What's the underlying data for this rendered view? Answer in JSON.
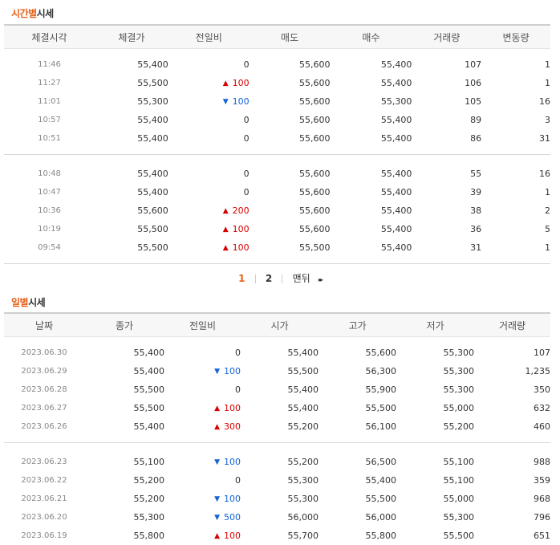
{
  "time_section": {
    "title_hl": "시간별",
    "title_rest": "시세",
    "headers": [
      "체결시각",
      "체결가",
      "전일비",
      "매도",
      "매수",
      "거래량",
      "변동량"
    ],
    "rows": [
      {
        "time": "11:46",
        "price": "55,400",
        "dir": "",
        "diff": "0",
        "ask": "55,600",
        "bid": "55,400",
        "volume": "107",
        "change": "1"
      },
      {
        "time": "11:27",
        "price": "55,500",
        "dir": "up",
        "diff": "100",
        "ask": "55,600",
        "bid": "55,400",
        "volume": "106",
        "change": "1"
      },
      {
        "time": "11:01",
        "price": "55,300",
        "dir": "down",
        "diff": "100",
        "ask": "55,600",
        "bid": "55,300",
        "volume": "105",
        "change": "16"
      },
      {
        "time": "10:57",
        "price": "55,400",
        "dir": "",
        "diff": "0",
        "ask": "55,600",
        "bid": "55,400",
        "volume": "89",
        "change": "3"
      },
      {
        "time": "10:51",
        "price": "55,400",
        "dir": "",
        "diff": "0",
        "ask": "55,600",
        "bid": "55,400",
        "volume": "86",
        "change": "31"
      },
      {
        "time": "10:48",
        "price": "55,400",
        "dir": "",
        "diff": "0",
        "ask": "55,600",
        "bid": "55,400",
        "volume": "55",
        "change": "16"
      },
      {
        "time": "10:47",
        "price": "55,400",
        "dir": "",
        "diff": "0",
        "ask": "55,600",
        "bid": "55,400",
        "volume": "39",
        "change": "1"
      },
      {
        "time": "10:36",
        "price": "55,600",
        "dir": "up",
        "diff": "200",
        "ask": "55,600",
        "bid": "55,400",
        "volume": "38",
        "change": "2"
      },
      {
        "time": "10:19",
        "price": "55,500",
        "dir": "up",
        "diff": "100",
        "ask": "55,600",
        "bid": "55,400",
        "volume": "36",
        "change": "5"
      },
      {
        "time": "09:54",
        "price": "55,500",
        "dir": "up",
        "diff": "100",
        "ask": "55,500",
        "bid": "55,400",
        "volume": "31",
        "change": "1"
      }
    ]
  },
  "pager": {
    "page1": "1",
    "page2": "2",
    "last": "맨뒤",
    "next_icon": "▸▸"
  },
  "day_section": {
    "title_hl": "일별",
    "title_rest": "시세",
    "headers": [
      "날짜",
      "종가",
      "전일비",
      "시가",
      "고가",
      "저가",
      "거래량"
    ],
    "rows": [
      {
        "date": "2023.06.30",
        "close": "55,400",
        "dir": "",
        "diff": "0",
        "open": "55,400",
        "high": "55,600",
        "low": "55,300",
        "volume": "107"
      },
      {
        "date": "2023.06.29",
        "close": "55,400",
        "dir": "down",
        "diff": "100",
        "open": "55,500",
        "high": "56,300",
        "low": "55,300",
        "volume": "1,235"
      },
      {
        "date": "2023.06.28",
        "close": "55,500",
        "dir": "",
        "diff": "0",
        "open": "55,400",
        "high": "55,900",
        "low": "55,300",
        "volume": "350"
      },
      {
        "date": "2023.06.27",
        "close": "55,500",
        "dir": "up",
        "diff": "100",
        "open": "55,400",
        "high": "55,500",
        "low": "55,000",
        "volume": "632"
      },
      {
        "date": "2023.06.26",
        "close": "55,400",
        "dir": "up",
        "diff": "300",
        "open": "55,200",
        "high": "56,100",
        "low": "55,200",
        "volume": "460"
      },
      {
        "date": "2023.06.23",
        "close": "55,100",
        "dir": "down",
        "diff": "100",
        "open": "55,200",
        "high": "56,500",
        "low": "55,100",
        "volume": "988"
      },
      {
        "date": "2023.06.22",
        "close": "55,200",
        "dir": "",
        "diff": "0",
        "open": "55,300",
        "high": "55,400",
        "low": "55,100",
        "volume": "359"
      },
      {
        "date": "2023.06.21",
        "close": "55,200",
        "dir": "down",
        "diff": "100",
        "open": "55,300",
        "high": "55,500",
        "low": "55,000",
        "volume": "968"
      },
      {
        "date": "2023.06.20",
        "close": "55,300",
        "dir": "down",
        "diff": "500",
        "open": "56,000",
        "high": "56,000",
        "low": "55,300",
        "volume": "796"
      },
      {
        "date": "2023.06.19",
        "close": "55,800",
        "dir": "up",
        "diff": "100",
        "open": "55,700",
        "high": "55,800",
        "low": "55,500",
        "volume": "651"
      }
    ]
  },
  "arrows": {
    "up": "▲",
    "down": "▼"
  },
  "colors": {
    "accent": "#e8611a",
    "up": "#d60000",
    "down": "#1262d6"
  }
}
